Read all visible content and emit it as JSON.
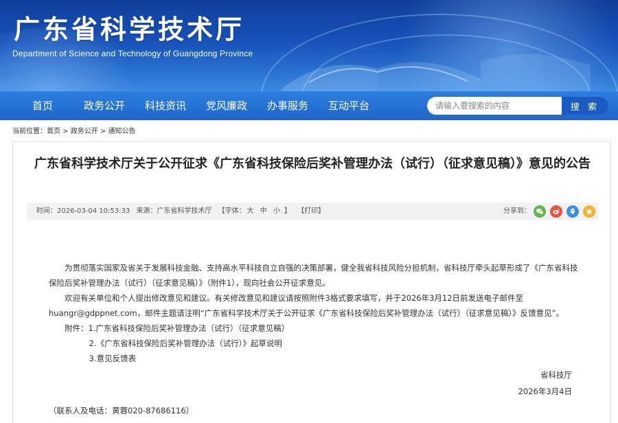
{
  "header": {
    "title": "广东省科学技术厅",
    "subtitle": "Department of Science and Technology of Guangdong Province"
  },
  "nav": {
    "items": [
      "首页",
      "政务公开",
      "科技资讯",
      "党风廉政",
      "办事服务",
      "互动平台"
    ]
  },
  "search": {
    "placeholder": "请输入要搜索的内容",
    "button_label": "搜 索"
  },
  "breadcrumb": {
    "prefix": "当前位置：",
    "items": [
      "首页",
      "政务公开",
      "通知公告"
    ],
    "separator": " > "
  },
  "article": {
    "title": "广东省科学技术厅关于公开征求《广东省科技保险后奖补管理办法（试行）（征求意见稿）》意见的公告",
    "meta": {
      "time": "时间：2026-03-04 10:53:33",
      "source": "来源：广东省科学技术厅",
      "font_label": "【字体：",
      "font_large": "大",
      "font_medium": "中",
      "font_small": "小",
      "font_close": "】",
      "print": "【打印】",
      "share_label": "分享到："
    },
    "share_icons": [
      {
        "name": "wechat-icon",
        "color": "#5fb84d"
      },
      {
        "name": "weibo-icon",
        "color": "#e8523f"
      },
      {
        "name": "qq-icon",
        "color": "#3a8ee6"
      },
      {
        "name": "qzone-icon",
        "color": "#f2b32e"
      }
    ],
    "paragraphs": [
      "为贯彻落实国家及省关于发展科技金融、支持高水平科技自立自强的决策部署，健全我省科技风险分担机制，省科技厅牵头起草形成了《广东省科技保险后奖补管理办法（试行）（征求意见稿）》（附件1），现向社会公开征求意见。",
      "欢迎有关单位和个人提出修改意见和建议。有关修改意见和建议请按照附件3格式要求填写，并于2026年3月12日前发送电子邮件至huangr@gdppnet.com，邮件主题请注明“广东省科学技术厅关于公开征求《广东省科技保险后奖补管理办法（试行）（征求意见稿）》反馈意见”。"
    ],
    "attachments_label": "附件：",
    "attachments": [
      "1.广东省科技保险后奖补管理办法（试行）（征求意见稿）",
      "2.《广东省科技保险后奖补管理办法（试行）》起草说明",
      "3.意见反馈表"
    ],
    "signature": "省科技厅",
    "date": "2026年3月4日",
    "contact": "（联系人及电话：黄蓉020-87686116）"
  }
}
